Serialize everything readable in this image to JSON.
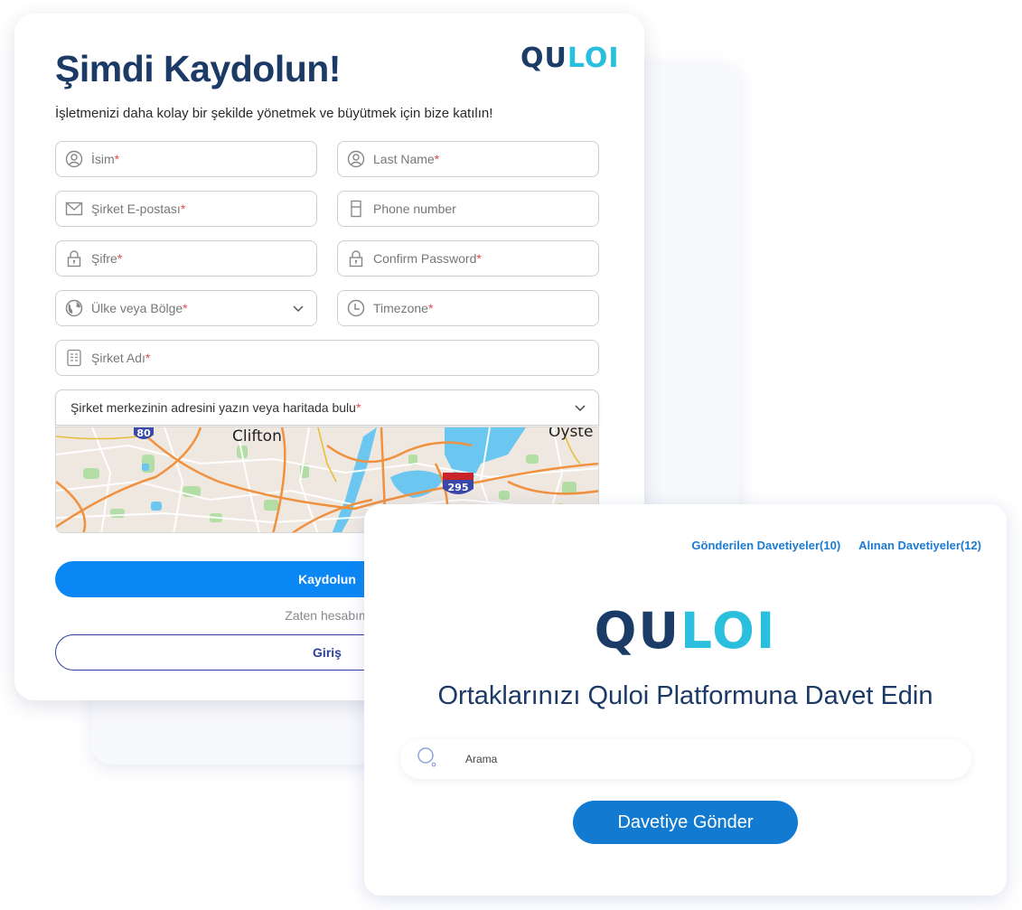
{
  "signup": {
    "logo": {
      "dark": "QU",
      "light": "LOI"
    },
    "title": "Şimdi Kaydolun!",
    "subtitle": "İşletmenizi daha kolay bir şekilde yönetmek ve büyütmek için bize katılın!",
    "fields": {
      "first_name": {
        "label": "İsim",
        "required": "*",
        "icon": "user-icon"
      },
      "last_name": {
        "label": "Last Name",
        "required": "*",
        "icon": "user-icon"
      },
      "email": {
        "label": "Şirket E-postası",
        "required": "*",
        "icon": "mail-icon"
      },
      "phone": {
        "label": "Phone number",
        "required": "",
        "icon": "phone-icon"
      },
      "password": {
        "label": "Şifre",
        "required": "*",
        "icon": "lock-icon"
      },
      "confirm_password": {
        "label": "Confirm Password",
        "required": "*",
        "icon": "lock-icon"
      },
      "country": {
        "label": "Ülke veya Bölge",
        "required": "*",
        "icon": "globe-icon"
      },
      "timezone": {
        "label": "Timezone",
        "required": "*",
        "icon": "clock-icon"
      },
      "company": {
        "label": "Şirket Adı",
        "required": "*",
        "icon": "building-icon"
      },
      "address": {
        "label": "Şirket merkezinin adresini yazın veya haritada bulu",
        "required": "*"
      }
    },
    "map": {
      "labels": [
        "Clifton",
        "Oyste"
      ],
      "shields": [
        "80",
        "295"
      ]
    },
    "submit_label": "Kaydolun",
    "have_account": "Zaten hesabım",
    "login_label": "Giriş"
  },
  "invite": {
    "links": [
      "Gönderilen Davetiyeler(10)",
      "Alınan Davetiyeler(12)"
    ],
    "logo": {
      "dark": "QU",
      "light": "LOI"
    },
    "title": "Ortaklarınızı Quloi Platformuna Davet Edin",
    "search_placeholder": "Arama",
    "send_label": "Davetiye Gönder"
  },
  "colors": {
    "brand_dark": "#1c3c68",
    "brand_light": "#2bbfde",
    "primary": "#0a87f5",
    "required": "#e5484d"
  }
}
